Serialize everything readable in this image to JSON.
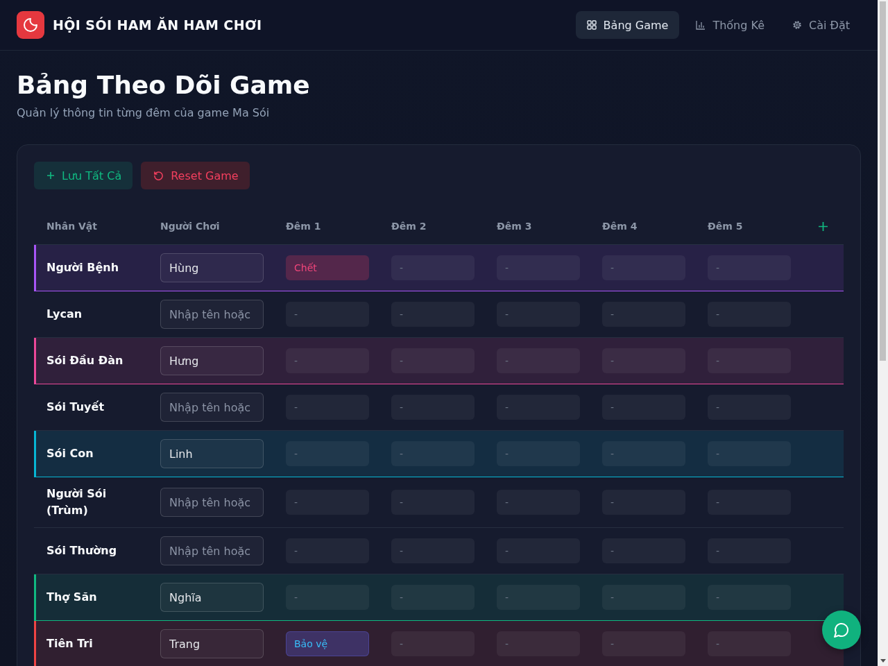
{
  "header": {
    "title": "HỘI SÓI HAM ĂN HAM CHƠI",
    "nav": [
      {
        "label": "Bảng Game",
        "selected": true
      },
      {
        "label": "Thống Kê",
        "selected": false
      },
      {
        "label": "Cài Đặt",
        "selected": false
      }
    ]
  },
  "page": {
    "title": "Bảng Theo Dõi Game",
    "subtitle": "Quản lý thông tin từng đêm của game Ma Sói"
  },
  "toolbar": [
    {
      "label": "Lưu Tất Cả",
      "kind": "save"
    },
    {
      "label": "Reset Game",
      "kind": "reset"
    }
  ],
  "table": {
    "columns": [
      "Nhân Vật",
      "Người Chơi",
      "Đêm 1",
      "Đêm 2",
      "Đêm 3",
      "Đêm 4",
      "Đêm 5"
    ],
    "rows": [
      {
        "role": "Người Bệnh",
        "player": "Hùng",
        "color": "#a855f7",
        "nights": [
          {
            "text": "Chết",
            "kind": "dead"
          },
          {
            "text": "-",
            "kind": "empty"
          },
          {
            "text": "-",
            "kind": "empty"
          },
          {
            "text": "-",
            "kind": "empty"
          },
          {
            "text": "-",
            "kind": "empty"
          }
        ]
      },
      {
        "role": "Lycan",
        "placeholder": "Nhập tên hoặc",
        "nights": [
          {
            "text": "-",
            "kind": "empty"
          },
          {
            "text": "-",
            "kind": "empty"
          },
          {
            "text": "-",
            "kind": "empty"
          },
          {
            "text": "-",
            "kind": "empty"
          },
          {
            "text": "-",
            "kind": "empty"
          }
        ]
      },
      {
        "role": "Sói Đầu Đàn",
        "player": "Hưng",
        "color": "#ec4899",
        "nights": [
          {
            "text": "-",
            "kind": "empty"
          },
          {
            "text": "-",
            "kind": "empty"
          },
          {
            "text": "-",
            "kind": "empty"
          },
          {
            "text": "-",
            "kind": "empty"
          },
          {
            "text": "-",
            "kind": "empty"
          }
        ]
      },
      {
        "role": "Sói Tuyết",
        "placeholder": "Nhập tên hoặc",
        "nights": [
          {
            "text": "-",
            "kind": "empty"
          },
          {
            "text": "-",
            "kind": "empty"
          },
          {
            "text": "-",
            "kind": "empty"
          },
          {
            "text": "-",
            "kind": "empty"
          },
          {
            "text": "-",
            "kind": "empty"
          }
        ]
      },
      {
        "role": "Sói Con",
        "player": "Linh",
        "color": "#06b6d4",
        "nights": [
          {
            "text": "-",
            "kind": "empty"
          },
          {
            "text": "-",
            "kind": "empty"
          },
          {
            "text": "-",
            "kind": "empty"
          },
          {
            "text": "-",
            "kind": "empty"
          },
          {
            "text": "-",
            "kind": "empty"
          }
        ]
      },
      {
        "role": "Người Sói (Trùm)",
        "placeholder": "Nhập tên hoặc",
        "nights": [
          {
            "text": "-",
            "kind": "empty"
          },
          {
            "text": "-",
            "kind": "empty"
          },
          {
            "text": "-",
            "kind": "empty"
          },
          {
            "text": "-",
            "kind": "empty"
          },
          {
            "text": "-",
            "kind": "empty"
          }
        ]
      },
      {
        "role": "Sói Thường",
        "placeholder": "Nhập tên hoặc",
        "nights": [
          {
            "text": "-",
            "kind": "empty"
          },
          {
            "text": "-",
            "kind": "empty"
          },
          {
            "text": "-",
            "kind": "empty"
          },
          {
            "text": "-",
            "kind": "empty"
          },
          {
            "text": "-",
            "kind": "empty"
          }
        ]
      },
      {
        "role": "Thợ Săn",
        "player": "Nghĩa",
        "color": "#10b981",
        "nights": [
          {
            "text": "-",
            "kind": "empty"
          },
          {
            "text": "-",
            "kind": "empty"
          },
          {
            "text": "-",
            "kind": "empty"
          },
          {
            "text": "-",
            "kind": "empty"
          },
          {
            "text": "-",
            "kind": "empty"
          }
        ]
      },
      {
        "role": "Tiên Tri",
        "player": "Trang",
        "color": "#ef4444",
        "nights": [
          {
            "text": "Bảo vệ",
            "kind": "protected"
          },
          {
            "text": "-",
            "kind": "empty"
          },
          {
            "text": "-",
            "kind": "empty"
          },
          {
            "text": "-",
            "kind": "empty"
          },
          {
            "text": "-",
            "kind": "empty"
          }
        ]
      }
    ]
  }
}
